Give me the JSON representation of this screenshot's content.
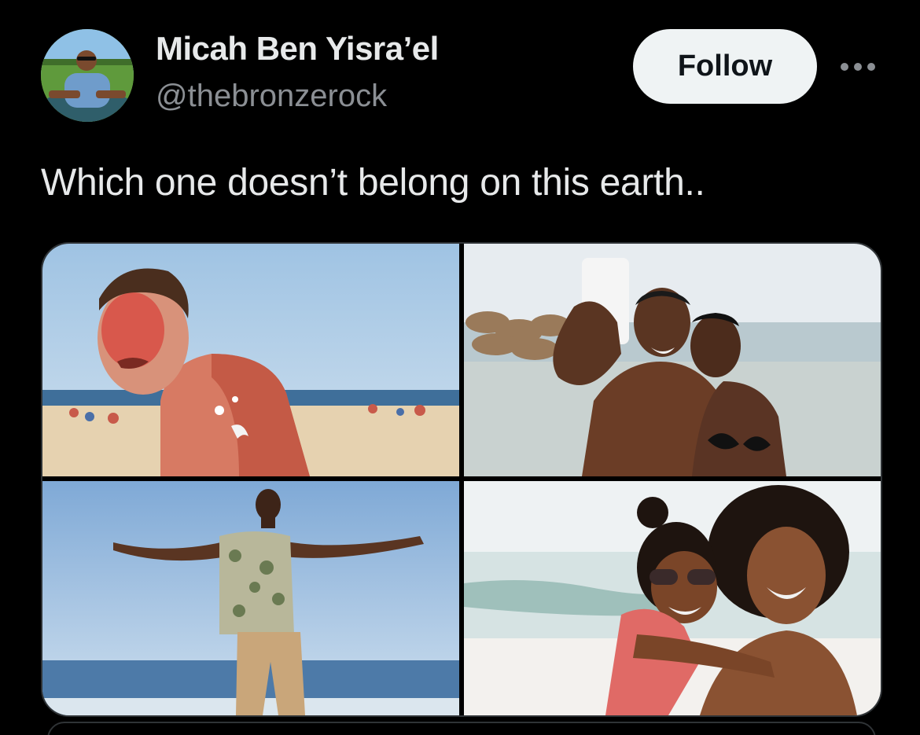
{
  "author": {
    "display_name": "Micah Ben Yisra’el",
    "handle": "@thebronzerock",
    "avatar_icon": "profile-photo"
  },
  "actions": {
    "follow_label": "Follow",
    "more_icon": "more-horizontal-icon"
  },
  "tweet": {
    "text": "Which one doesn’t belong on this earth.."
  },
  "media": [
    {
      "description_icon": "sunburned-man-photo"
    },
    {
      "description_icon": "couple-selfie-photo"
    },
    {
      "description_icon": "man-arms-outstretched-photo"
    },
    {
      "description_icon": "mother-daughter-beach-photo"
    }
  ],
  "colors": {
    "background": "#000000",
    "primary_text": "#e7e9ea",
    "secondary_text": "#8b8f94",
    "follow_bg": "#eff3f4",
    "follow_text": "#0f1419",
    "border": "#2f3336"
  }
}
